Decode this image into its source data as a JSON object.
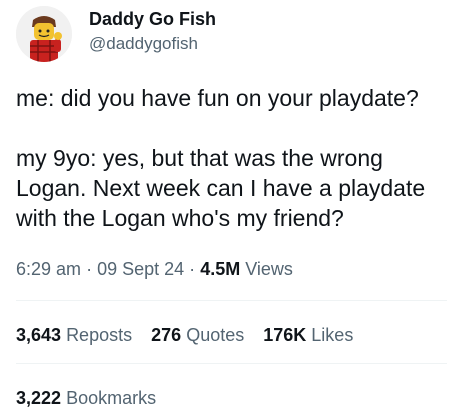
{
  "author": {
    "display_name": "Daddy Go Fish",
    "handle": "@daddygofish",
    "avatar_icon": "lego-figure-avatar"
  },
  "post": {
    "lines": [
      "me: did you have fun on your playdate?",
      "",
      "my 9yo: yes, but that was the wrong Logan. Next week can I have a playdate with the Logan who's my friend?"
    ]
  },
  "meta": {
    "time": "6:29 am",
    "date": "09 Sept 24",
    "sep": "·",
    "views_count": "4.5M",
    "views_label": "Views"
  },
  "stats": {
    "reposts_count": "3,643",
    "reposts_label": "Reposts",
    "quotes_count": "276",
    "quotes_label": "Quotes",
    "likes_count": "176K",
    "likes_label": "Likes"
  },
  "bookmarks": {
    "count": "3,222",
    "label": "Bookmarks"
  }
}
